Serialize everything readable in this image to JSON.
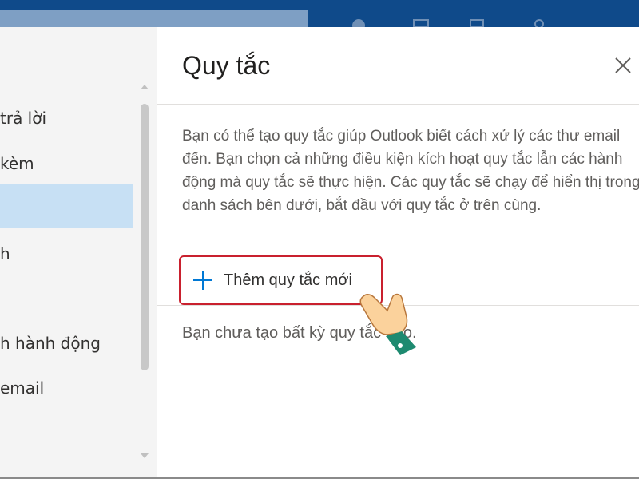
{
  "sidebar": {
    "items": [
      {
        "label": "trả lời"
      },
      {
        "label": " kèm"
      },
      {
        "label": ""
      },
      {
        "label": "h"
      },
      {
        "label": ""
      },
      {
        "label": "h hành động"
      },
      {
        "label": " email"
      }
    ],
    "selected_index": 2
  },
  "dialog": {
    "title": "Quy tắc",
    "description": "Bạn có thể tạo quy tắc giúp Outlook biết cách xử lý các thư email đến. Bạn chọn cả những điều kiện kích hoạt quy tắc lẫn các hành động mà quy tắc sẽ thực hiện. Các quy tắc sẽ chạy để hiển thị trong danh sách bên dưới, bắt đầu với quy tắc ở trên cùng.",
    "add_rule_label": "Thêm quy tắc mới",
    "empty_text": "Bạn chưa tạo bất kỳ quy tắc nào."
  },
  "icons": {
    "close": "close-icon",
    "plus": "plus-icon",
    "pointer": "pointing-hand-icon"
  },
  "colors": {
    "topbar": "#0f4a8a",
    "selected": "#c7e0f4",
    "highlight": "#c9202e",
    "accent": "#0078d4"
  }
}
